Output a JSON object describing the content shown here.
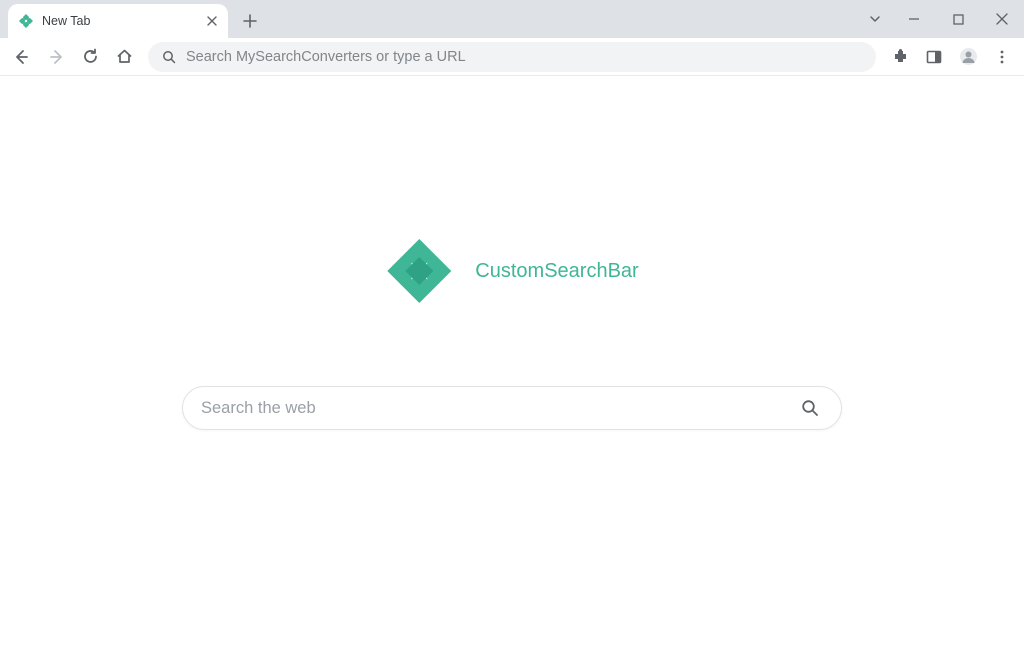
{
  "tab": {
    "title": "New Tab"
  },
  "omnibox": {
    "placeholder": "Search MySearchConverters or type a URL"
  },
  "brand": {
    "name": "CustomSearchBar",
    "color": "#3fb695"
  },
  "search": {
    "placeholder": "Search the web"
  },
  "icons": {
    "back": "back-icon",
    "forward": "forward-icon",
    "reload": "reload-icon",
    "home": "home-icon",
    "search": "search-icon",
    "extensions": "extensions-icon",
    "sidepanel": "sidepanel-icon",
    "profile": "profile-icon",
    "menu": "menu-icon",
    "close": "close-icon",
    "newtab": "plus-icon",
    "tabs_dropdown": "chevron-down-icon",
    "minimize": "minimize-icon",
    "maximize": "maximize-icon",
    "win_close": "close-icon"
  }
}
